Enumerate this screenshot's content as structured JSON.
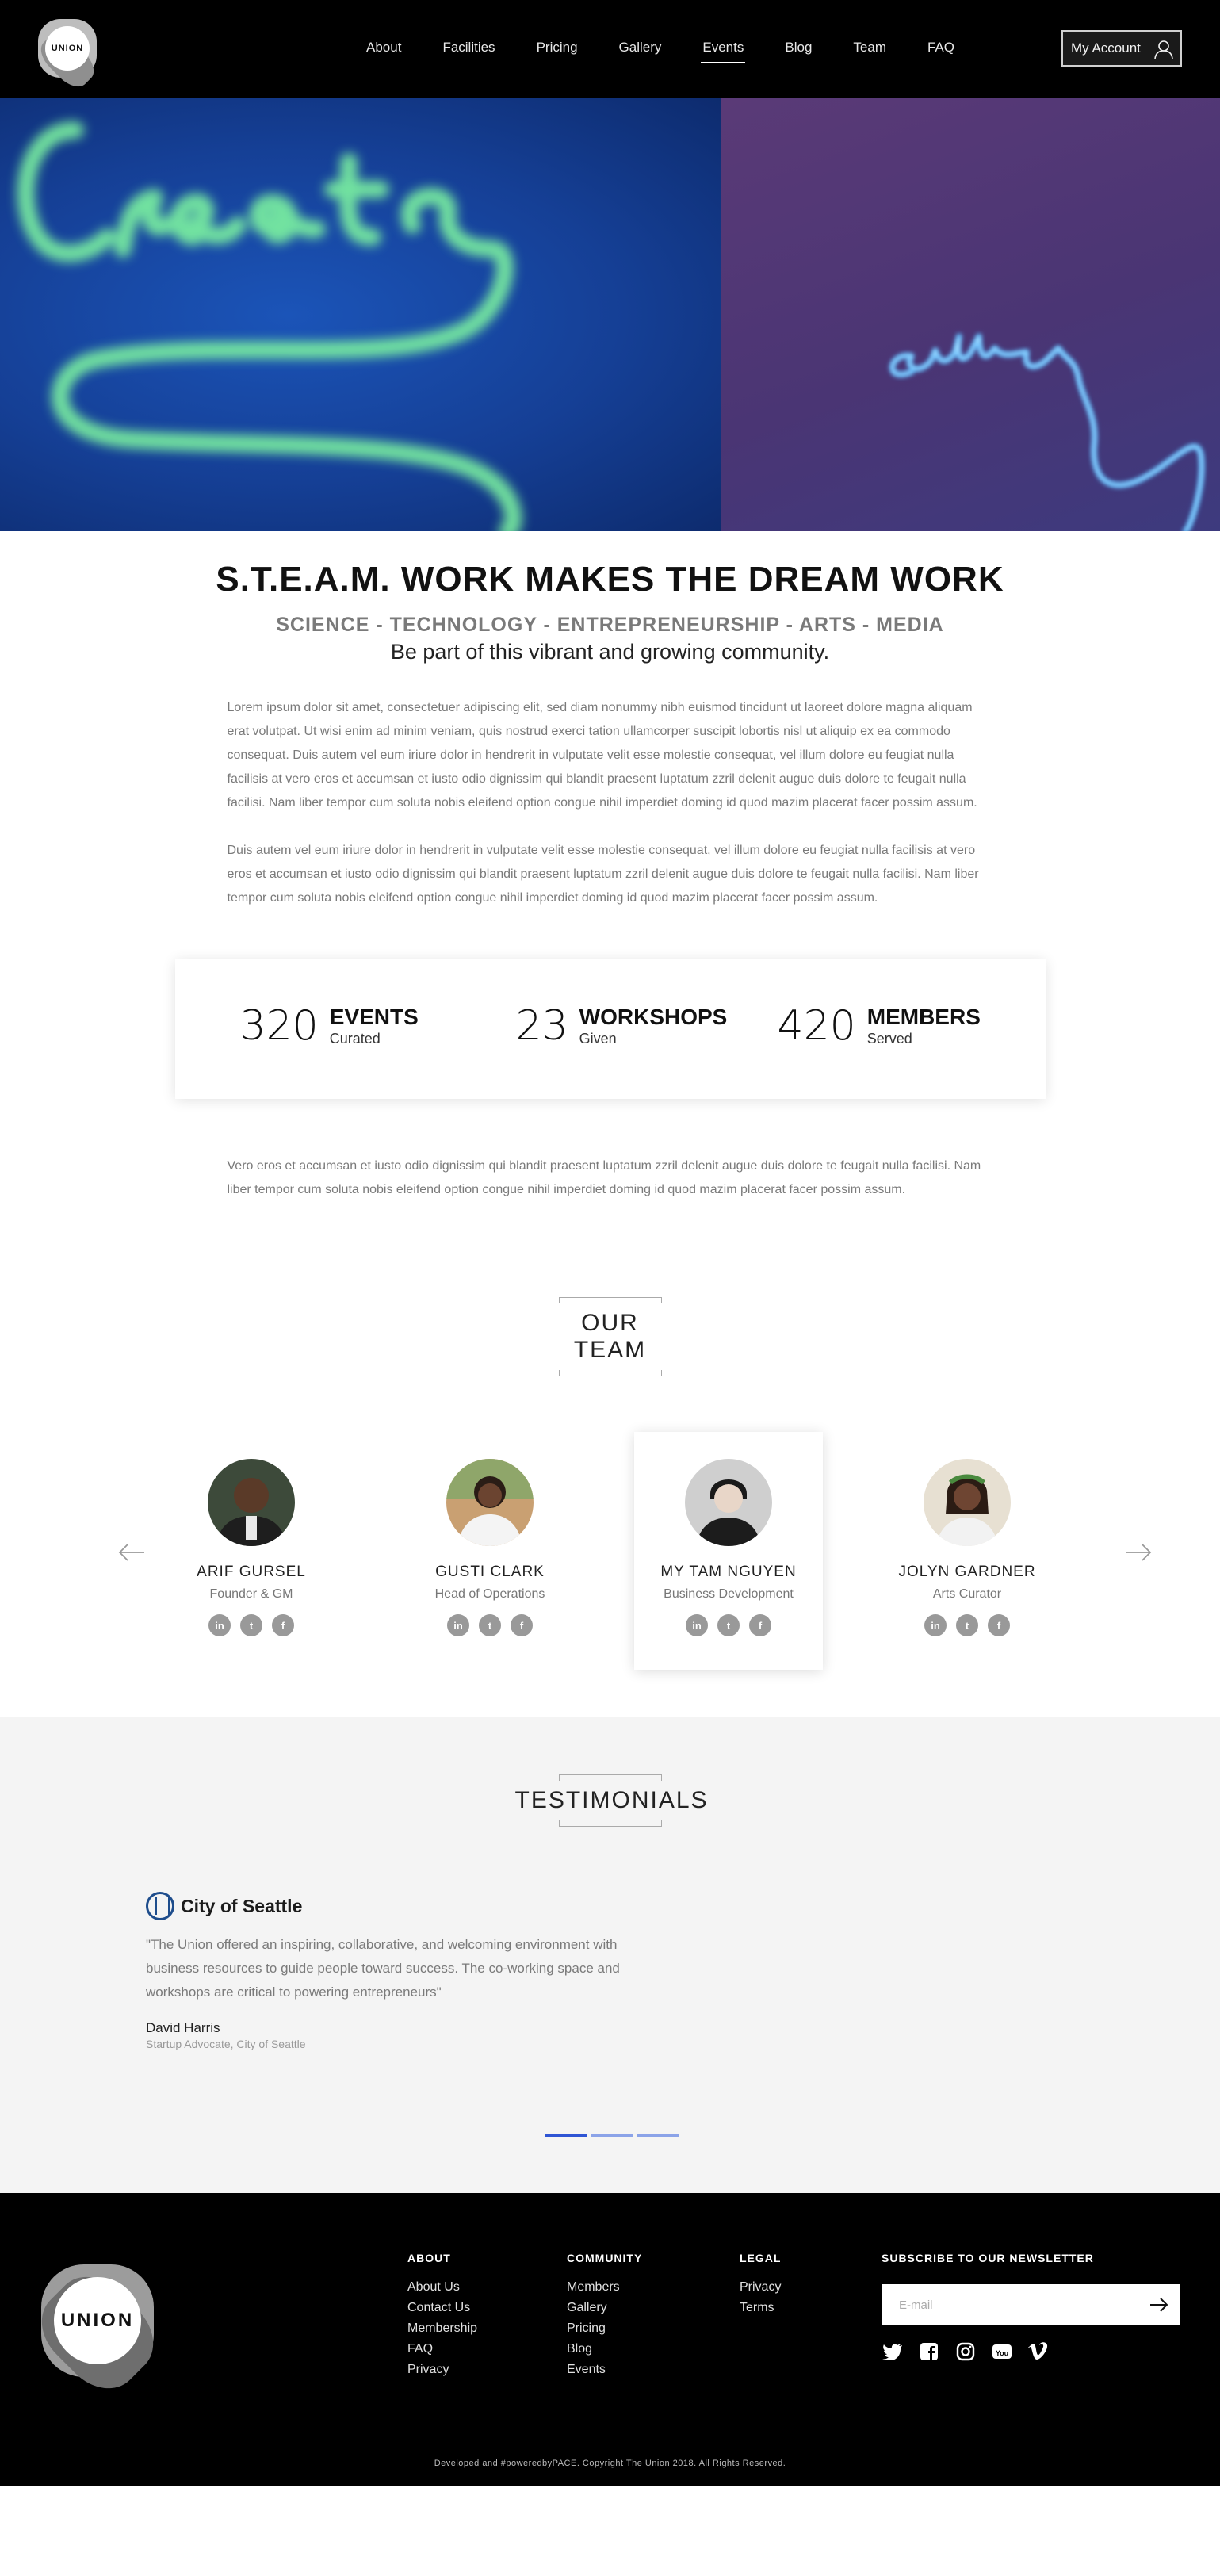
{
  "header": {
    "logo_text": "UNION",
    "nav": [
      "About",
      "Facilities",
      "Pricing",
      "Gallery",
      "Events",
      "Blog",
      "Team",
      "FAQ"
    ],
    "active_nav": "Events",
    "account_label": "My Account"
  },
  "hero": {
    "neon_left": "Create",
    "neon_right": "culture",
    "colors": {
      "left_bg": "#1b54b8",
      "right_bg": "#4a3574",
      "neon_green": "#7cf3a0",
      "neon_blue": "#4fb6ff"
    }
  },
  "intro": {
    "headline": "S.T.E.A.M. WORK MAKES THE DREAM WORK",
    "subhead": "SCIENCE - TECHNOLOGY - ENTREPRENEURSHIP - ARTS - MEDIA",
    "tagline": "Be part of this vibrant and growing community.",
    "paragraph1": "Lorem ipsum dolor sit amet, consectetuer adipiscing elit, sed diam nonummy nibh euismod tincidunt ut laoreet dolore magna aliquam erat volutpat. Ut wisi enim ad minim veniam, quis nostrud exerci tation ullamcorper suscipit lobortis nisl ut aliquip ex ea commodo consequat. Duis autem vel eum iriure dolor in hendrerit in vulputate velit esse molestie consequat, vel illum dolore eu feugiat nulla facilisis at vero eros et accumsan et iusto odio dignissim qui blandit praesent luptatum zzril delenit augue duis dolore te feugait nulla facilisi. Nam liber tempor cum soluta nobis eleifend option congue nihil imperdiet doming id quod mazim placerat facer possim assum.",
    "paragraph2": "Duis autem vel eum iriure dolor in hendrerit in vulputate velit esse molestie consequat, vel illum dolore eu feugiat nulla facilisis at vero eros et accumsan et iusto odio dignissim qui blandit praesent luptatum zzril delenit augue duis dolore te feugait nulla facilisi. Nam liber tempor cum soluta nobis eleifend option congue nihil imperdiet doming id quod mazim placerat facer possim assum.",
    "paragraph3": "Vero eros et accumsan et iusto odio dignissim qui blandit praesent luptatum zzril delenit augue duis dolore te feugait nulla facilisi. Nam liber tempor cum soluta nobis eleifend option congue nihil imperdiet doming id quod mazim placerat facer possim assum."
  },
  "stats": [
    {
      "value": "320",
      "label": "EVENTS",
      "sub": "Curated"
    },
    {
      "value": "23",
      "label": "WORKSHOPS",
      "sub": "Given"
    },
    {
      "value": "420",
      "label": "MEMBERS",
      "sub": "Served"
    }
  ],
  "team": {
    "title": "OUR TEAM",
    "members": [
      {
        "name": "ARIF GURSEL",
        "role": "Founder & GM",
        "featured": false,
        "skin": "#5a3a28",
        "bg": "#3d4a3a"
      },
      {
        "name": "GUSTI CLARK",
        "role": "Head of Operations",
        "featured": false,
        "skin": "#6b4430",
        "bg": "#c9a072"
      },
      {
        "name": "MY TAM NGUYEN",
        "role": "Business Development",
        "featured": true,
        "skin": "#e8d6c8",
        "bg": "#cfcfcf"
      },
      {
        "name": "JOLYN GARDNER",
        "role": "Arts Curator",
        "featured": false,
        "skin": "#6e4532",
        "bg": "#e7e0d2"
      }
    ],
    "social_icons": [
      "linkedin-icon",
      "twitter-icon",
      "facebook-icon"
    ]
  },
  "testimonials": {
    "title": "TESTIMONIALS",
    "logo_text": "City of Seattle",
    "quote": "\"The Union offered an inspiring, collaborative, and welcoming environment with business resources to guide people toward success. The co-working space and workshops are critical to powering entrepreneurs\"",
    "author": "David Harris",
    "author_role": "Startup Advocate, City of Seattle",
    "slides": 3,
    "active_slide": 1
  },
  "footer": {
    "logo_text": "UNION",
    "columns": [
      {
        "title": "ABOUT",
        "links": [
          "About Us",
          "Contact Us",
          "Membership",
          "FAQ",
          "Privacy"
        ]
      },
      {
        "title": "COMMUNITY",
        "links": [
          "Members",
          "Gallery",
          "Pricing",
          "Blog",
          "Events"
        ]
      },
      {
        "title": "LEGAL",
        "links": [
          "Privacy",
          "Terms"
        ]
      }
    ],
    "newsletter_title": "SUBSCRIBE TO OUR NEWSLETTER",
    "email_placeholder": "E-mail",
    "social_icons": [
      "twitter-icon",
      "facebook-icon",
      "instagram-icon",
      "youtube-icon",
      "vimeo-icon"
    ],
    "copyright": "Developed and #poweredbyPACE. Copyright The Union 2018. All Rights Reserved."
  }
}
